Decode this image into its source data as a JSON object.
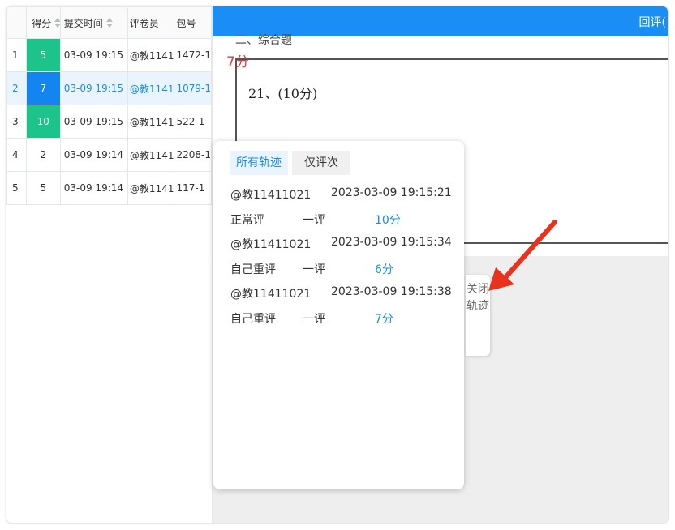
{
  "table": {
    "headers": {
      "score": "得分",
      "time": "提交时间",
      "reviewer": "评卷员",
      "package": "包号"
    },
    "rows": [
      {
        "index": "1",
        "score": "5",
        "time": "03-09 19:15",
        "reviewer": "@教1141",
        "package": "1472-1"
      },
      {
        "index": "2",
        "score": "7",
        "time": "03-09 19:15",
        "reviewer": "@教1141",
        "package": "1079-1"
      },
      {
        "index": "3",
        "score": "10",
        "time": "03-09 19:15",
        "reviewer": "@教1141",
        "package": "522-1"
      },
      {
        "index": "4",
        "score": "2",
        "time": "03-09 19:14",
        "reviewer": "@教1141",
        "package": "2208-1"
      },
      {
        "index": "5",
        "score": "5",
        "time": "03-09 19:14",
        "reviewer": "@教1141",
        "package": "117-1"
      }
    ]
  },
  "topbar": {
    "text": "回评("
  },
  "paper": {
    "heading": "二、综合题",
    "current_score": "7分",
    "question": "21、(10分)"
  },
  "popup": {
    "tab_all": "所有轨迹",
    "tab_only": "仅评次",
    "entries": [
      {
        "reviewer": "@教11411021",
        "time": "2023-03-09 19:15:21",
        "kind": "正常评",
        "round": "一评",
        "points": "10分"
      },
      {
        "reviewer": "@教11411021",
        "time": "2023-03-09 19:15:34",
        "kind": "自己重评",
        "round": "一评",
        "points": "6分"
      },
      {
        "reviewer": "@教11411021",
        "time": "2023-03-09 19:15:38",
        "kind": "自己重评",
        "round": "一评",
        "points": "7分"
      }
    ]
  },
  "close_tab": {
    "label": "关闭轨迹"
  },
  "colors": {
    "accent": "#1a8ef5",
    "green": "#1cc48c",
    "blue": "#1384f0",
    "annotation_arrow": "#e8321e"
  }
}
